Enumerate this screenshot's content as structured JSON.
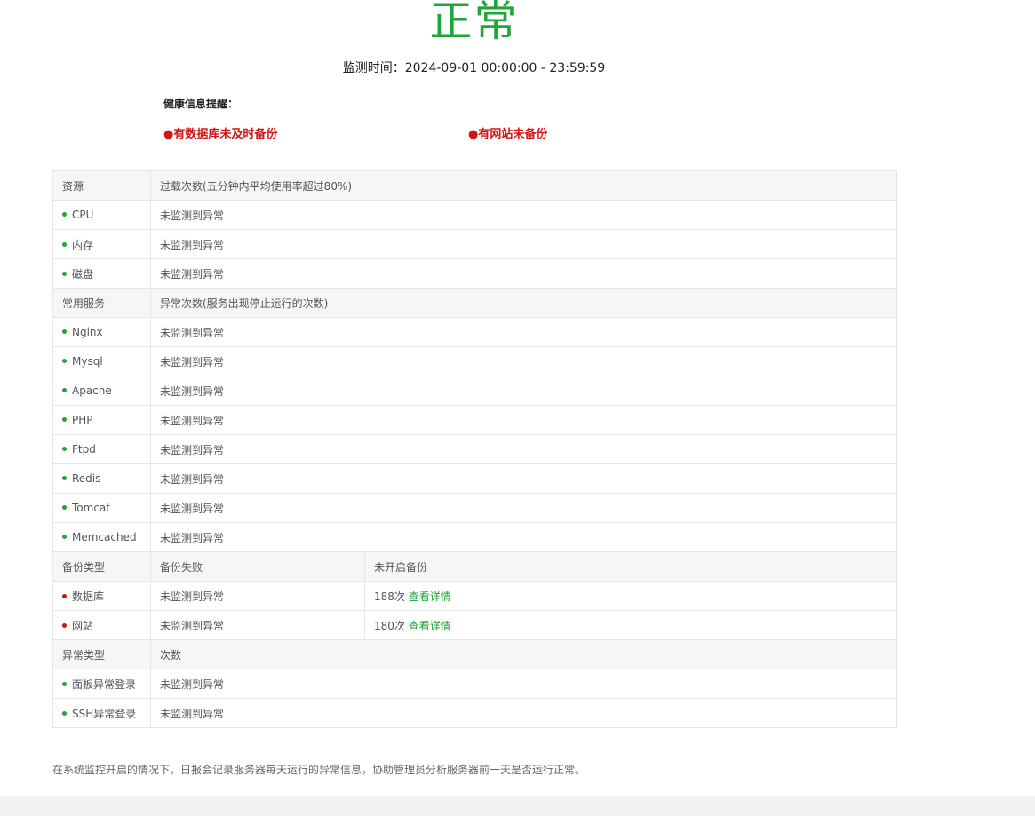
{
  "status": {
    "title": "正常",
    "monitor_time": "监测时间：2024-09-01 00:00:00 - 23:59:59"
  },
  "health": {
    "label": "健康信息提醒：",
    "alerts": [
      "●有数据库未及时备份",
      "●有网站未备份"
    ]
  },
  "colors": {
    "accent": "#20a53a",
    "alert": "#d21414",
    "header_bg": "#f6f6f6"
  },
  "sections": {
    "resource": {
      "header": [
        "资源",
        "过载次数(五分钟内平均使用率超过80%)"
      ],
      "rows": [
        {
          "name": "CPU",
          "value": "未监测到异常",
          "status": "green"
        },
        {
          "name": "内存",
          "value": "未监测到异常",
          "status": "green"
        },
        {
          "name": "磁盘",
          "value": "未监测到异常",
          "status": "green"
        }
      ]
    },
    "services": {
      "header": [
        "常用服务",
        "异常次数(服务出现停止运行的次数)"
      ],
      "rows": [
        {
          "name": "Nginx",
          "value": "未监测到异常",
          "status": "green"
        },
        {
          "name": "Mysql",
          "value": "未监测到异常",
          "status": "green"
        },
        {
          "name": "Apache",
          "value": "未监测到异常",
          "status": "green"
        },
        {
          "name": "PHP",
          "value": "未监测到异常",
          "status": "green"
        },
        {
          "name": "Ftpd",
          "value": "未监测到异常",
          "status": "green"
        },
        {
          "name": "Redis",
          "value": "未监测到异常",
          "status": "green"
        },
        {
          "name": "Tomcat",
          "value": "未监测到异常",
          "status": "green"
        },
        {
          "name": "Memcached",
          "value": "未监测到异常",
          "status": "green"
        }
      ]
    },
    "backup": {
      "header": [
        "备份类型",
        "备份失败",
        "未开启备份"
      ],
      "rows": [
        {
          "name": "数据库",
          "failed": "未监测到异常",
          "not_enabled": "188次",
          "link": "查看详情",
          "status": "red"
        },
        {
          "name": "网站",
          "failed": "未监测到异常",
          "not_enabled": "180次",
          "link": "查看详情",
          "status": "red"
        }
      ]
    },
    "anomaly": {
      "header": [
        "异常类型",
        "次数"
      ],
      "rows": [
        {
          "name": "面板异常登录",
          "value": "未监测到异常",
          "status": "green"
        },
        {
          "name": "SSH异常登录",
          "value": "未监测到异常",
          "status": "green"
        }
      ]
    }
  },
  "footer": {
    "note": "在系统监控开启的情况下，日报会记录服务器每天运行的异常信息，协助管理员分析服务器前一天是否运行正常。"
  }
}
